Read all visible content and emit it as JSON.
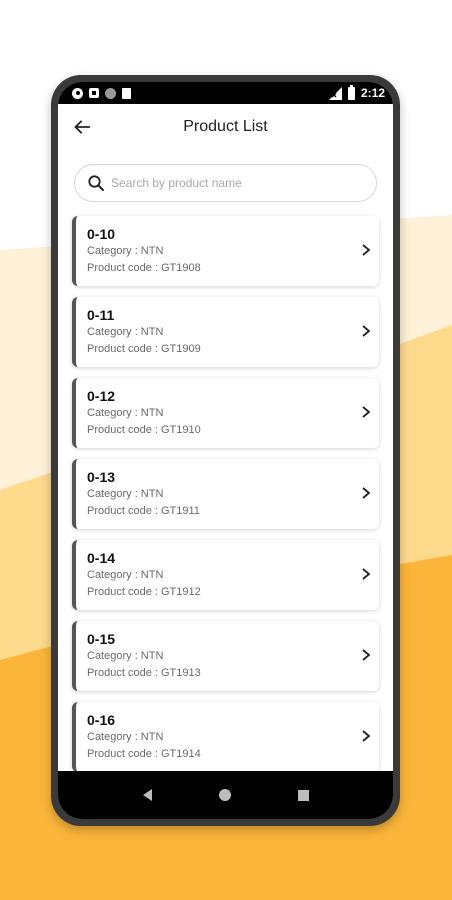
{
  "status_bar": {
    "time": "2:12",
    "left_icons": [
      "settings-icon",
      "sd-card-icon",
      "circle-icon",
      "sim-card-icon"
    ],
    "right_icons": [
      "signal-icon",
      "battery-icon"
    ]
  },
  "header": {
    "title": "Product List",
    "back_icon": "arrow-left-icon"
  },
  "search": {
    "placeholder": "Search by product name",
    "value": ""
  },
  "products": [
    {
      "name": "0-10",
      "category": "Category : NTN",
      "code": "Product code : GT1908"
    },
    {
      "name": "0-11",
      "category": "Category : NTN",
      "code": "Product code : GT1909"
    },
    {
      "name": "0-12",
      "category": "Category : NTN",
      "code": "Product code : GT1910"
    },
    {
      "name": "0-13",
      "category": "Category : NTN",
      "code": "Product code : GT1911"
    },
    {
      "name": "0-14",
      "category": "Category : NTN",
      "code": "Product code : GT1912"
    },
    {
      "name": "0-15",
      "category": "Category : NTN",
      "code": "Product code : GT1913"
    },
    {
      "name": "0-16",
      "category": "Category : NTN",
      "code": "Product code : GT1914"
    }
  ],
  "nav_bar": {
    "buttons": [
      "back-triangle-icon",
      "home-circle-icon",
      "recents-square-icon"
    ]
  },
  "colors": {
    "background_accent": "#fbb53a",
    "background_light": "#fde9c4",
    "card_border": "#555555",
    "phone_frame": "#3a3a3a"
  }
}
